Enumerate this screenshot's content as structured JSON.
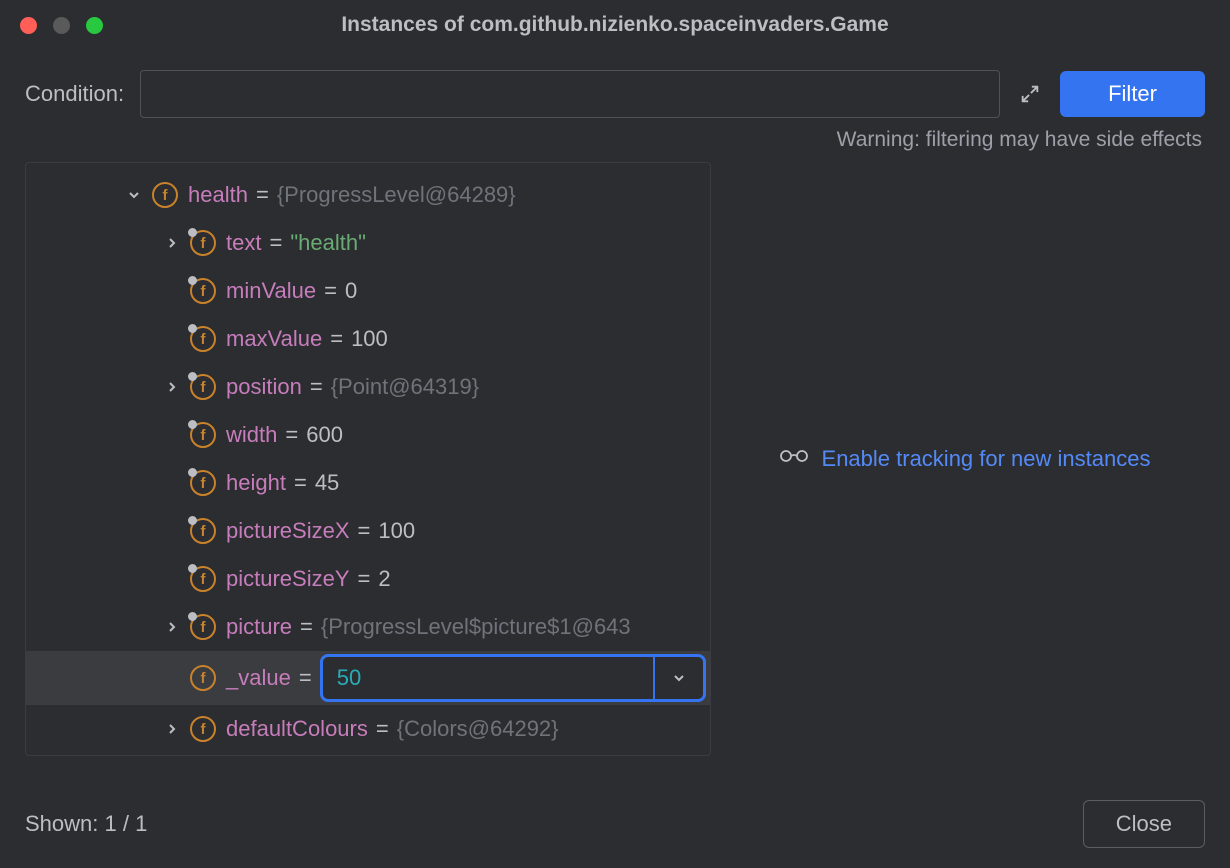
{
  "window": {
    "title": "Instances of com.github.nizienko.spaceinvaders.Game"
  },
  "filter": {
    "condition_label": "Condition:",
    "condition_value": "",
    "button_label": "Filter",
    "warning": "Warning: filtering may have side effects"
  },
  "tree": {
    "root": {
      "name": "health",
      "value": "{ProgressLevel@64289}",
      "children": [
        {
          "name": "text",
          "value": "\"health\"",
          "type": "string",
          "expandable": true
        },
        {
          "name": "minValue",
          "value": "0",
          "type": "number",
          "expandable": false
        },
        {
          "name": "maxValue",
          "value": "100",
          "type": "number",
          "expandable": false
        },
        {
          "name": "position",
          "value": "{Point@64319}",
          "type": "object",
          "expandable": true
        },
        {
          "name": "width",
          "value": "600",
          "type": "number",
          "expandable": false
        },
        {
          "name": "height",
          "value": "45",
          "type": "number",
          "expandable": false
        },
        {
          "name": "pictureSizeX",
          "value": "100",
          "type": "number",
          "expandable": false
        },
        {
          "name": "pictureSizeY",
          "value": "2",
          "type": "number",
          "expandable": false
        },
        {
          "name": "picture",
          "value": "{ProgressLevel$picture$1@643",
          "type": "object",
          "expandable": true
        },
        {
          "name": "_value",
          "value": "50",
          "type": "editing",
          "expandable": false
        },
        {
          "name": "defaultColours",
          "value": "{Colors@64292}",
          "type": "object",
          "expandable": true
        }
      ]
    }
  },
  "side": {
    "track_link": "Enable tracking for new instances"
  },
  "footer": {
    "shown": "Shown: 1 / 1",
    "close": "Close"
  }
}
